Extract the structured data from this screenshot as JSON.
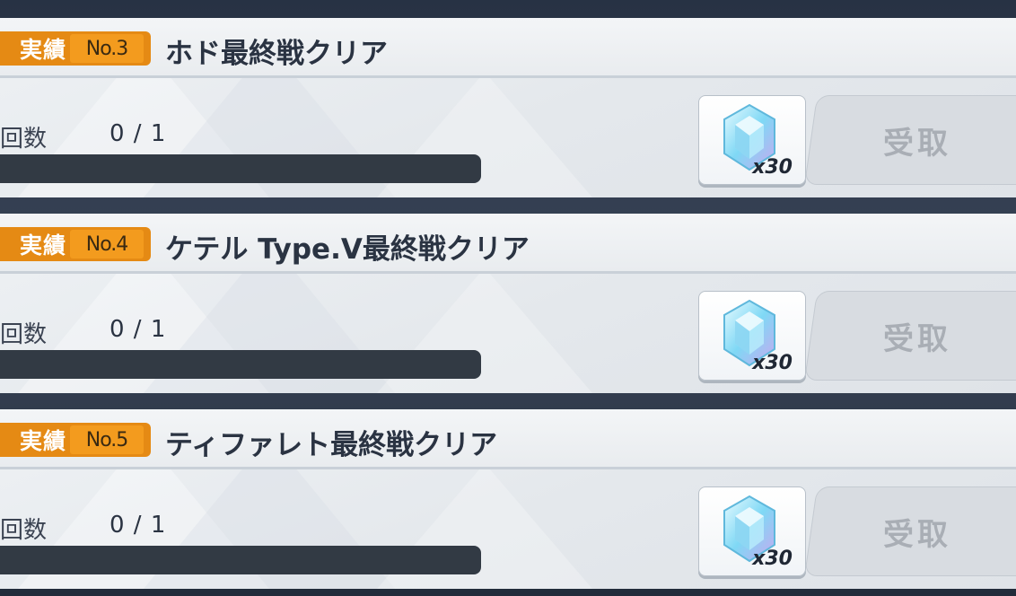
{
  "achievements": [
    {
      "category": "実績",
      "number": "No.3",
      "title": "ホド最終戦クリア",
      "count_label": "回数",
      "count_value": "0 / 1",
      "progress_fraction": 0,
      "reward_qty": "x30",
      "reward_icon": "crystal-gem-icon",
      "claim_label": "受取"
    },
    {
      "category": "実績",
      "number": "No.4",
      "title": "ケテル Type.V最終戦クリア",
      "count_label": "回数",
      "count_value": "0 / 1",
      "progress_fraction": 0,
      "reward_qty": "x30",
      "reward_icon": "crystal-gem-icon",
      "claim_label": "受取"
    },
    {
      "category": "実績",
      "number": "No.5",
      "title": "ティファレト最終戦クリア",
      "count_label": "回数",
      "count_value": "0 / 1",
      "progress_fraction": 0,
      "reward_qty": "x30",
      "reward_icon": "crystal-gem-icon",
      "claim_label": "受取"
    }
  ],
  "colors": {
    "badge_orange": "#e58a14",
    "badge_number_orange": "#f39b1e",
    "progress_track": "#323a44",
    "claim_disabled": "#d8dce1"
  }
}
